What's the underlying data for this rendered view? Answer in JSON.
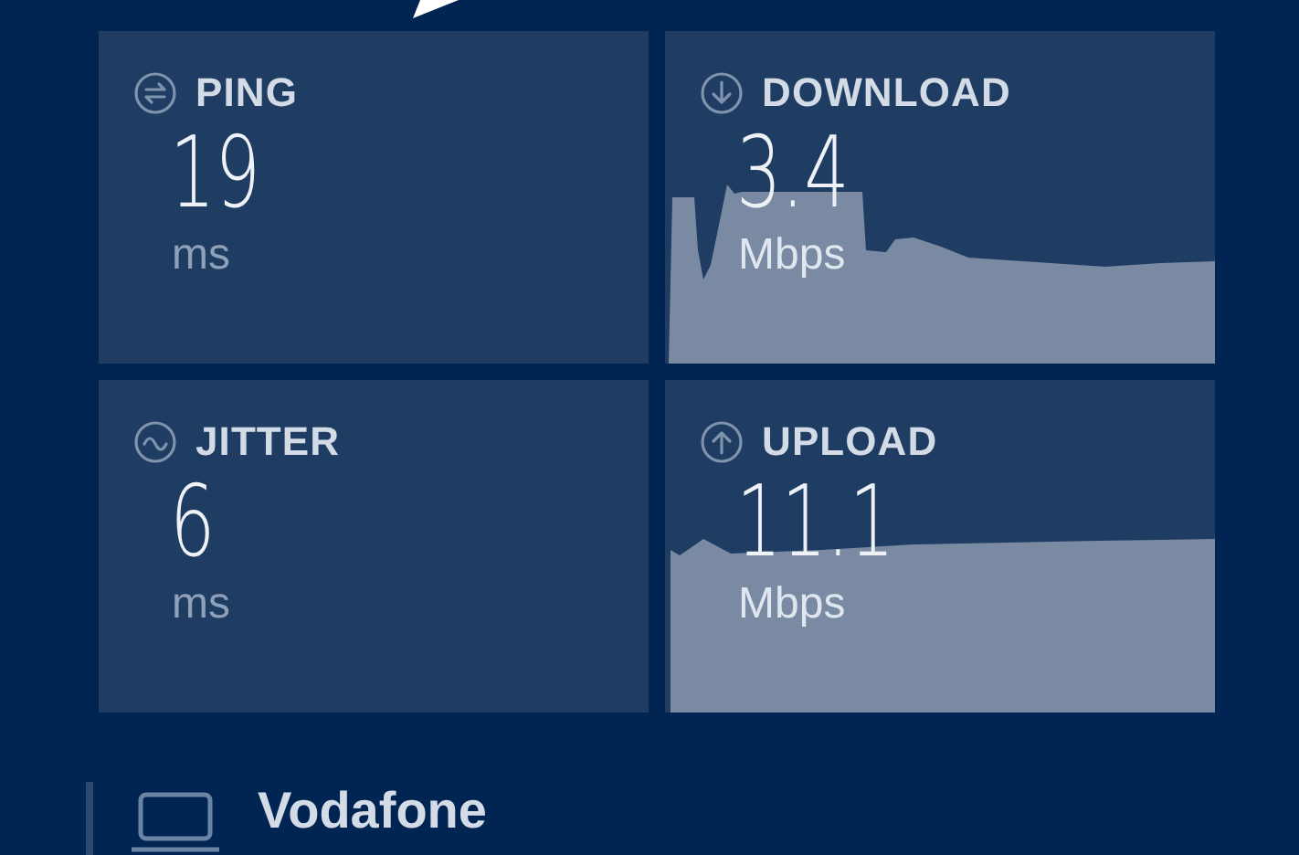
{
  "results": [
    {
      "kind": "plain",
      "title": "PING",
      "value": "19",
      "unit": "ms"
    },
    {
      "kind": "graph",
      "title": "DOWNLOAD",
      "value": "3.4",
      "unit": "Mbps"
    },
    {
      "kind": "plain",
      "title": "JITTER",
      "value": "6",
      "unit": "ms"
    },
    {
      "kind": "graph",
      "title": "UPLOAD",
      "value": "11.1",
      "unit": "Mbps"
    }
  ],
  "connection": {
    "provider": "Vodafone"
  }
}
